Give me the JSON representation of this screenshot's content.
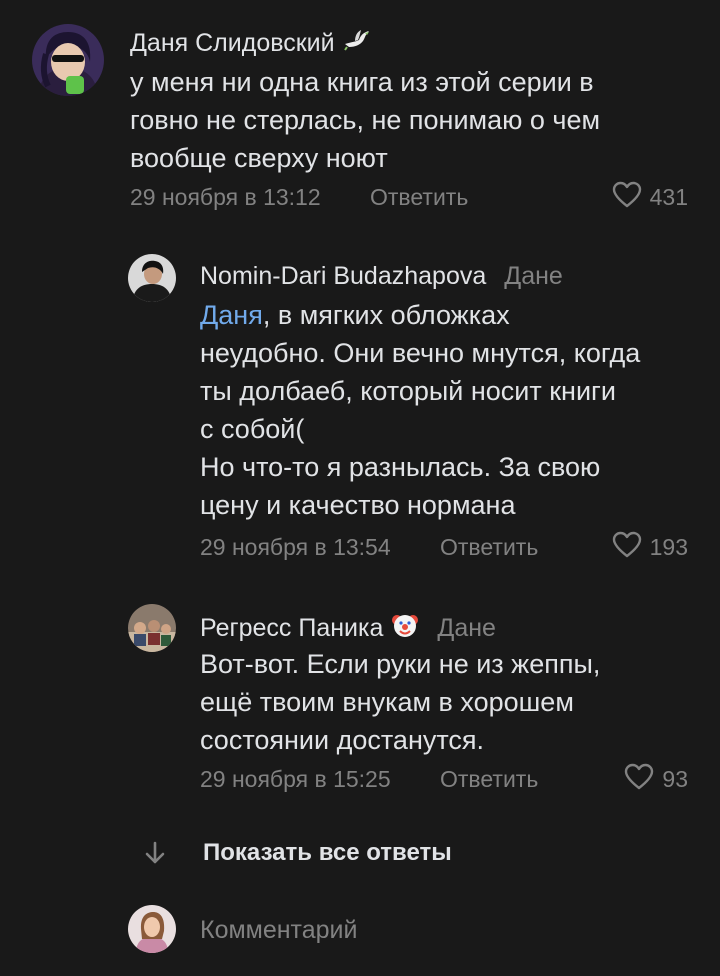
{
  "comments": [
    {
      "author": "Даня Слидовский",
      "lines": [
        "у меня ни одна книга из этой серии в",
        "говно не стерлась, не понимаю о чем",
        "вообще сверху ноют"
      ],
      "date": "29 ноября в 13:12",
      "reply_label": "Ответить",
      "likes": "431"
    },
    {
      "author": "Nomin-Dari Budazhapova",
      "reply_to": "Дане",
      "mention": "Даня",
      "first_line_rest": ", в мягких обложках",
      "lines": [
        "неудобно. Они вечно мнутся, когда",
        "ты долбаеб, который носит книги",
        "с собой(",
        "Но что-то я разнылась. За свою",
        "цену и качество нормана"
      ],
      "date": "29 ноября в 13:54",
      "reply_label": "Ответить",
      "likes": "193"
    },
    {
      "author": "Регресс Паника",
      "reply_to": "Дане",
      "lines": [
        "Вот-вот. Если руки не из жеппы,",
        "ещё твоим внукам в хорошем",
        "состоянии достанутся."
      ],
      "date": "29 ноября в 15:25",
      "reply_label": "Ответить",
      "likes": "93"
    }
  ],
  "show_all_label": "Показать все ответы",
  "comment_placeholder": "Комментарий",
  "colors": {
    "background": "#191919",
    "text": "#e1e3e6",
    "secondary": "#828282",
    "accent": "#71aaeb"
  },
  "icons": [
    "dove-icon",
    "heart-icon",
    "clown-icon",
    "arrow-down-icon"
  ]
}
